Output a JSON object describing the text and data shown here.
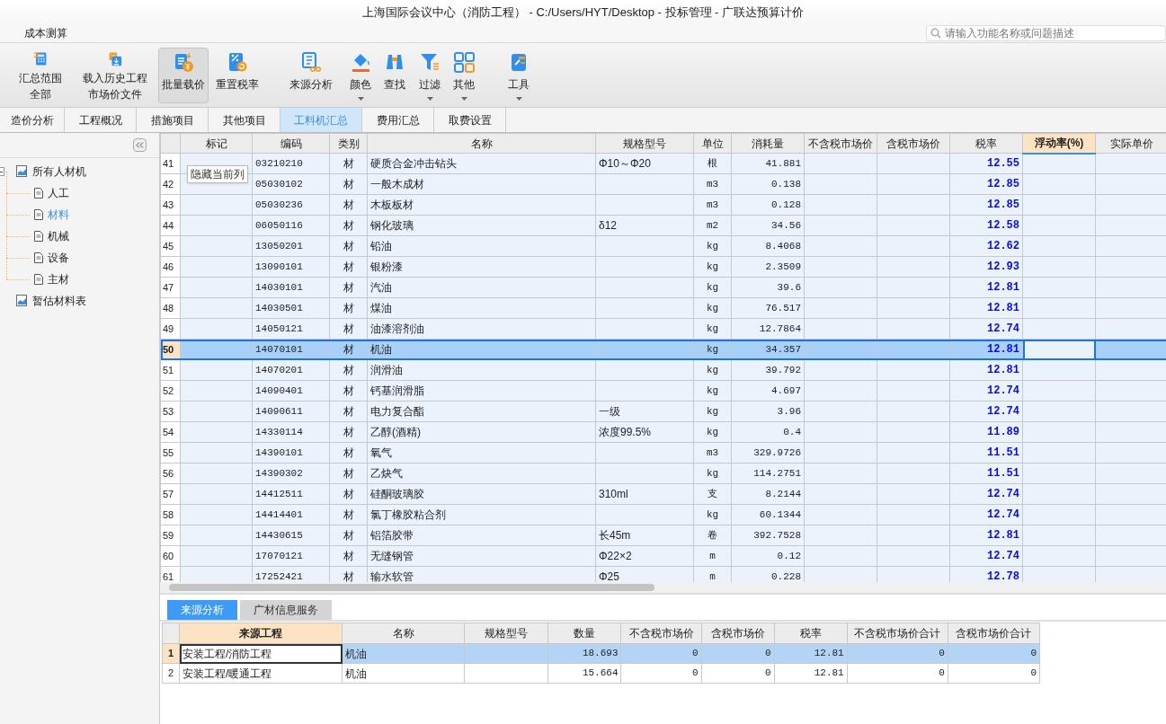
{
  "window": {
    "title": "上海国际会议中心（消防工程） - C:/Users/HYT/Desktop - 投标管理 - 广联达预算计价"
  },
  "menu": [
    {
      "label": "成本测算"
    }
  ],
  "search": {
    "placeholder": "请输入功能名称或问题描述"
  },
  "toolbar": [
    {
      "lines": [
        "汇总范围",
        "全部"
      ],
      "dropdown": false,
      "selected": false
    },
    {
      "lines": [
        "载入历史工程",
        "市场价文件"
      ],
      "dropdown": false,
      "selected": false
    },
    {
      "lines": [
        "批量载价"
      ],
      "dropdown": false,
      "selected": true
    },
    {
      "lines": [
        "重置税率"
      ],
      "dropdown": false,
      "selected": false
    },
    {
      "lines": [
        "来源分析"
      ],
      "dropdown": false,
      "selected": false
    },
    {
      "lines": [
        "颜色"
      ],
      "dropdown": true,
      "selected": false
    },
    {
      "lines": [
        "查找"
      ],
      "dropdown": false,
      "selected": false
    },
    {
      "lines": [
        "过滤"
      ],
      "dropdown": true,
      "selected": false
    },
    {
      "lines": [
        "其他"
      ],
      "dropdown": true,
      "selected": false
    },
    {
      "lines": [
        "工具"
      ],
      "dropdown": true,
      "selected": false
    }
  ],
  "tabs": [
    {
      "label": "造价分析",
      "selected": false
    },
    {
      "label": "工程概况",
      "selected": false
    },
    {
      "label": "措施项目",
      "selected": false
    },
    {
      "label": "其他项目",
      "selected": false
    },
    {
      "label": "工料机汇总",
      "selected": true
    },
    {
      "label": "费用汇总",
      "selected": false
    },
    {
      "label": "取费设置",
      "selected": false
    }
  ],
  "tree": [
    {
      "label": "所有人材机",
      "expanded": true,
      "selected": false,
      "children": [
        {
          "label": "人工",
          "selected": false
        },
        {
          "label": "材料",
          "selected": true
        },
        {
          "label": "机械",
          "selected": false
        },
        {
          "label": "设备",
          "selected": false
        },
        {
          "label": "主材",
          "selected": false
        }
      ]
    },
    {
      "label": "暂估材料表",
      "expanded": false,
      "selected": false
    }
  ],
  "table": {
    "columns": [
      {
        "label": "标记",
        "highlighted": false
      },
      {
        "label": "编码",
        "highlighted": false
      },
      {
        "label": "类别",
        "highlighted": false
      },
      {
        "label": "名称",
        "highlighted": false
      },
      {
        "label": "规格型号",
        "highlighted": false
      },
      {
        "label": "单位",
        "highlighted": false
      },
      {
        "label": "消耗量",
        "highlighted": false
      },
      {
        "label": "不含税市场价",
        "highlighted": false
      },
      {
        "label": "含税市场价",
        "highlighted": false
      },
      {
        "label": "税率",
        "highlighted": false
      },
      {
        "label": "浮动率(%)",
        "highlighted": true
      },
      {
        "label": "实际单价",
        "highlighted": false
      }
    ],
    "rows": [
      {
        "number": "41",
        "code": "03210210",
        "type": "材",
        "name": "硬质合金冲击钻头",
        "spec": "Φ10～Φ20",
        "unit": "根",
        "quantity": "41.881",
        "tax_rate": "12.55",
        "selected": false
      },
      {
        "number": "42",
        "code": "05030102",
        "type": "材",
        "name": "一般木成材",
        "unit": "m3",
        "quantity": "0.138",
        "tax_rate": "12.85",
        "selected": false
      },
      {
        "number": "43",
        "code": "05030236",
        "type": "材",
        "name": "木板板材",
        "unit": "m3",
        "quantity": "0.128",
        "tax_rate": "12.85",
        "selected": false
      },
      {
        "number": "44",
        "code": "06050116",
        "type": "材",
        "name": "钢化玻璃",
        "spec": "δ12",
        "unit": "m2",
        "quantity": "34.56",
        "tax_rate": "12.58",
        "selected": false
      },
      {
        "number": "45",
        "code": "13050201",
        "type": "材",
        "name": "铅油",
        "unit": "kg",
        "quantity": "8.4068",
        "tax_rate": "12.62",
        "selected": false
      },
      {
        "number": "46",
        "code": "13090101",
        "type": "材",
        "name": "银粉漆",
        "unit": "kg",
        "quantity": "2.3509",
        "tax_rate": "12.93",
        "selected": false
      },
      {
        "number": "47",
        "code": "14030101",
        "type": "材",
        "name": "汽油",
        "unit": "kg",
        "quantity": "39.6",
        "tax_rate": "12.81",
        "selected": false
      },
      {
        "number": "48",
        "code": "14030501",
        "type": "材",
        "name": "煤油",
        "unit": "kg",
        "quantity": "76.517",
        "tax_rate": "12.81",
        "selected": false
      },
      {
        "number": "49",
        "code": "14050121",
        "type": "材",
        "name": "油漆溶剂油",
        "unit": "kg",
        "quantity": "12.7864",
        "tax_rate": "12.74",
        "selected": false
      },
      {
        "number": "50",
        "code": "14070101",
        "type": "材",
        "name": "机油",
        "unit": "kg",
        "quantity": "34.357",
        "tax_rate": "12.81",
        "selected": true
      },
      {
        "number": "51",
        "code": "14070201",
        "type": "材",
        "name": "润滑油",
        "unit": "kg",
        "quantity": "39.792",
        "tax_rate": "12.81",
        "selected": false
      },
      {
        "number": "52",
        "code": "14090401",
        "type": "材",
        "name": "钙基润滑脂",
        "unit": "kg",
        "quantity": "4.697",
        "tax_rate": "12.74",
        "selected": false
      },
      {
        "number": "53",
        "code": "14090611",
        "type": "材",
        "name": "电力复合酯",
        "spec": "一级",
        "unit": "kg",
        "quantity": "3.96",
        "tax_rate": "12.74",
        "selected": false
      },
      {
        "number": "54",
        "code": "14330114",
        "type": "材",
        "name": "乙醇(酒精)",
        "spec": "浓度99.5%",
        "unit": "kg",
        "quantity": "0.4",
        "tax_rate": "11.89",
        "selected": false
      },
      {
        "number": "55",
        "code": "14390101",
        "type": "材",
        "name": "氧气",
        "unit": "m3",
        "quantity": "329.9726",
        "tax_rate": "11.51",
        "selected": false
      },
      {
        "number": "56",
        "code": "14390302",
        "type": "材",
        "name": "乙炔气",
        "unit": "kg",
        "quantity": "114.2751",
        "tax_rate": "11.51",
        "selected": false
      },
      {
        "number": "57",
        "code": "14412511",
        "type": "材",
        "name": "硅酮玻璃胶",
        "spec": "310ml",
        "unit": "支",
        "quantity": "8.2144",
        "tax_rate": "12.74",
        "selected": false
      },
      {
        "number": "58",
        "code": "14414401",
        "type": "材",
        "name": "氯丁橡胶粘合剂",
        "unit": "kg",
        "quantity": "60.1344",
        "tax_rate": "12.74",
        "selected": false
      },
      {
        "number": "59",
        "code": "14430615",
        "type": "材",
        "name": "铝箔胶带",
        "spec": "长45m",
        "unit": "卷",
        "quantity": "392.7528",
        "tax_rate": "12.81",
        "selected": false
      },
      {
        "number": "60",
        "code": "17070121",
        "type": "材",
        "name": "无缝钢管",
        "spec": "Φ22×2",
        "unit": "m",
        "quantity": "0.12",
        "tax_rate": "12.74",
        "selected": false
      },
      {
        "number": "61",
        "code": "17252421",
        "type": "材",
        "name": "输水软管",
        "spec": "Φ25",
        "unit": "m",
        "quantity": "0.228",
        "tax_rate": "12.78",
        "selected": false
      }
    ],
    "tooltip": {
      "text": "隐藏当前列"
    }
  },
  "bottom_tabs": [
    {
      "label": "来源分析",
      "selected": true
    },
    {
      "label": "广材信息服务",
      "selected": false
    }
  ],
  "source_table": {
    "columns": [
      {
        "label": "来源工程",
        "highlighted": true
      },
      {
        "label": "名称",
        "highlighted": false
      },
      {
        "label": "规格型号",
        "highlighted": false
      },
      {
        "label": "数量",
        "highlighted": false
      },
      {
        "label": "不含税市场价",
        "highlighted": false
      },
      {
        "label": "含税市场价",
        "highlighted": false
      },
      {
        "label": "税率",
        "highlighted": false
      },
      {
        "label": "不含税市场价合计",
        "highlighted": false
      },
      {
        "label": "含税市场价合计",
        "highlighted": false
      }
    ],
    "rows": [
      {
        "number": "1",
        "project": "安装工程/消防工程",
        "name": "机油",
        "quantity": "18.693",
        "price_ex": "0",
        "price_in": "0",
        "tax_rate": "12.81",
        "total_ex": "0",
        "total_in": "0",
        "selected": true
      },
      {
        "number": "2",
        "project": "安装工程/暖通工程",
        "name": "机油",
        "quantity": "15.664",
        "price_ex": "0",
        "price_in": "0",
        "tax_rate": "12.81",
        "total_ex": "0",
        "total_in": "0",
        "selected": false
      }
    ]
  }
}
